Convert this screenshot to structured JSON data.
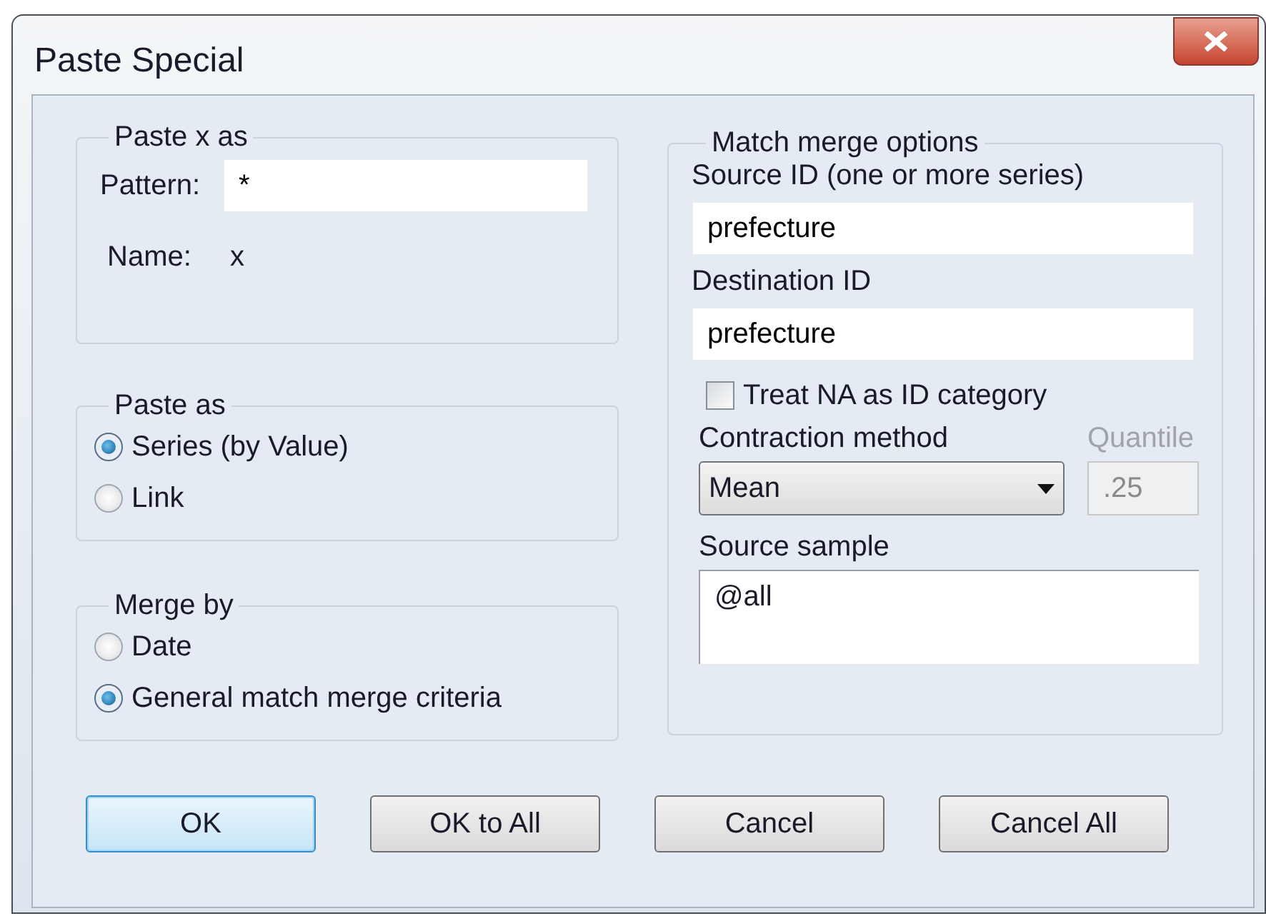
{
  "window": {
    "title": "Paste Special"
  },
  "paste_x_as": {
    "title": "Paste x as",
    "pattern_label": "Pattern:",
    "pattern_value": "*",
    "name_label": "Name:",
    "name_value": "x"
  },
  "paste_as": {
    "title": "Paste as",
    "options": [
      {
        "label": "Series (by Value)",
        "selected": true
      },
      {
        "label": "Link",
        "selected": false
      }
    ]
  },
  "merge_by": {
    "title": "Merge by",
    "options": [
      {
        "label": "Date",
        "selected": false
      },
      {
        "label": "General match merge criteria",
        "selected": true
      }
    ]
  },
  "match_merge": {
    "title": "Match merge options",
    "source_id_label": "Source ID (one or more series)",
    "source_id_value": "prefecture",
    "destination_id_label": "Destination ID",
    "destination_id_value": "prefecture",
    "treat_na": {
      "label": "Treat NA as ID category",
      "checked": false
    },
    "contraction_label": "Contraction method",
    "contraction_value": "Mean",
    "quantile_label": "Quantile",
    "quantile_value": ".25",
    "quantile_disabled": true,
    "source_sample_label": "Source sample",
    "source_sample_value": "@all"
  },
  "buttons": [
    {
      "label": "OK",
      "default": true
    },
    {
      "label": "OK to All",
      "default": false
    },
    {
      "label": "Cancel",
      "default": false
    },
    {
      "label": "Cancel All",
      "default": false
    }
  ]
}
